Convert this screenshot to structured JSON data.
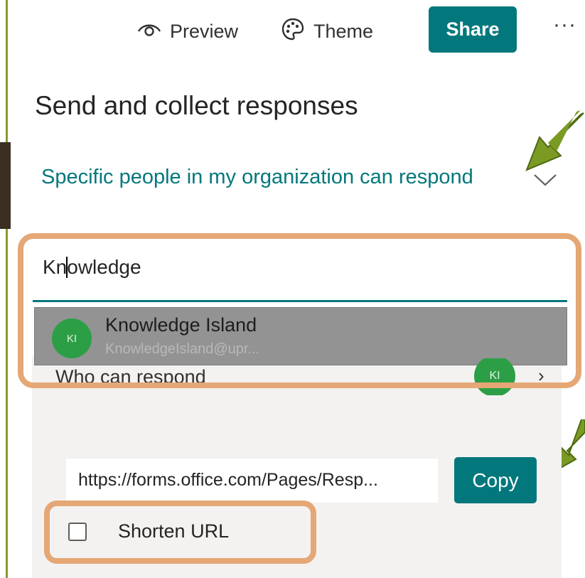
{
  "toolbar": {
    "preview_label": "Preview",
    "theme_label": "Theme",
    "share_label": "Share",
    "more_label": "···"
  },
  "title": "Send and collect responses",
  "audience": {
    "label": "Specific people in my organization can respond"
  },
  "search": {
    "value": "Knowledge"
  },
  "suggestion": {
    "initials": "KI",
    "name": "Knowledge Island",
    "email": "KnowledgeIsland@upr..."
  },
  "who_can_respond": {
    "label": "Who can respond",
    "avatar_initials": "KI"
  },
  "link": {
    "url": "https://forms.office.com/Pages/Resp...",
    "copy_label": "Copy"
  },
  "shorten": {
    "label": "Shorten URL",
    "checked": false
  },
  "colors": {
    "accent": "#03787c",
    "highlight": "#e5a775",
    "arrow": "#7a9a23",
    "avatar": "#2c9f46"
  }
}
